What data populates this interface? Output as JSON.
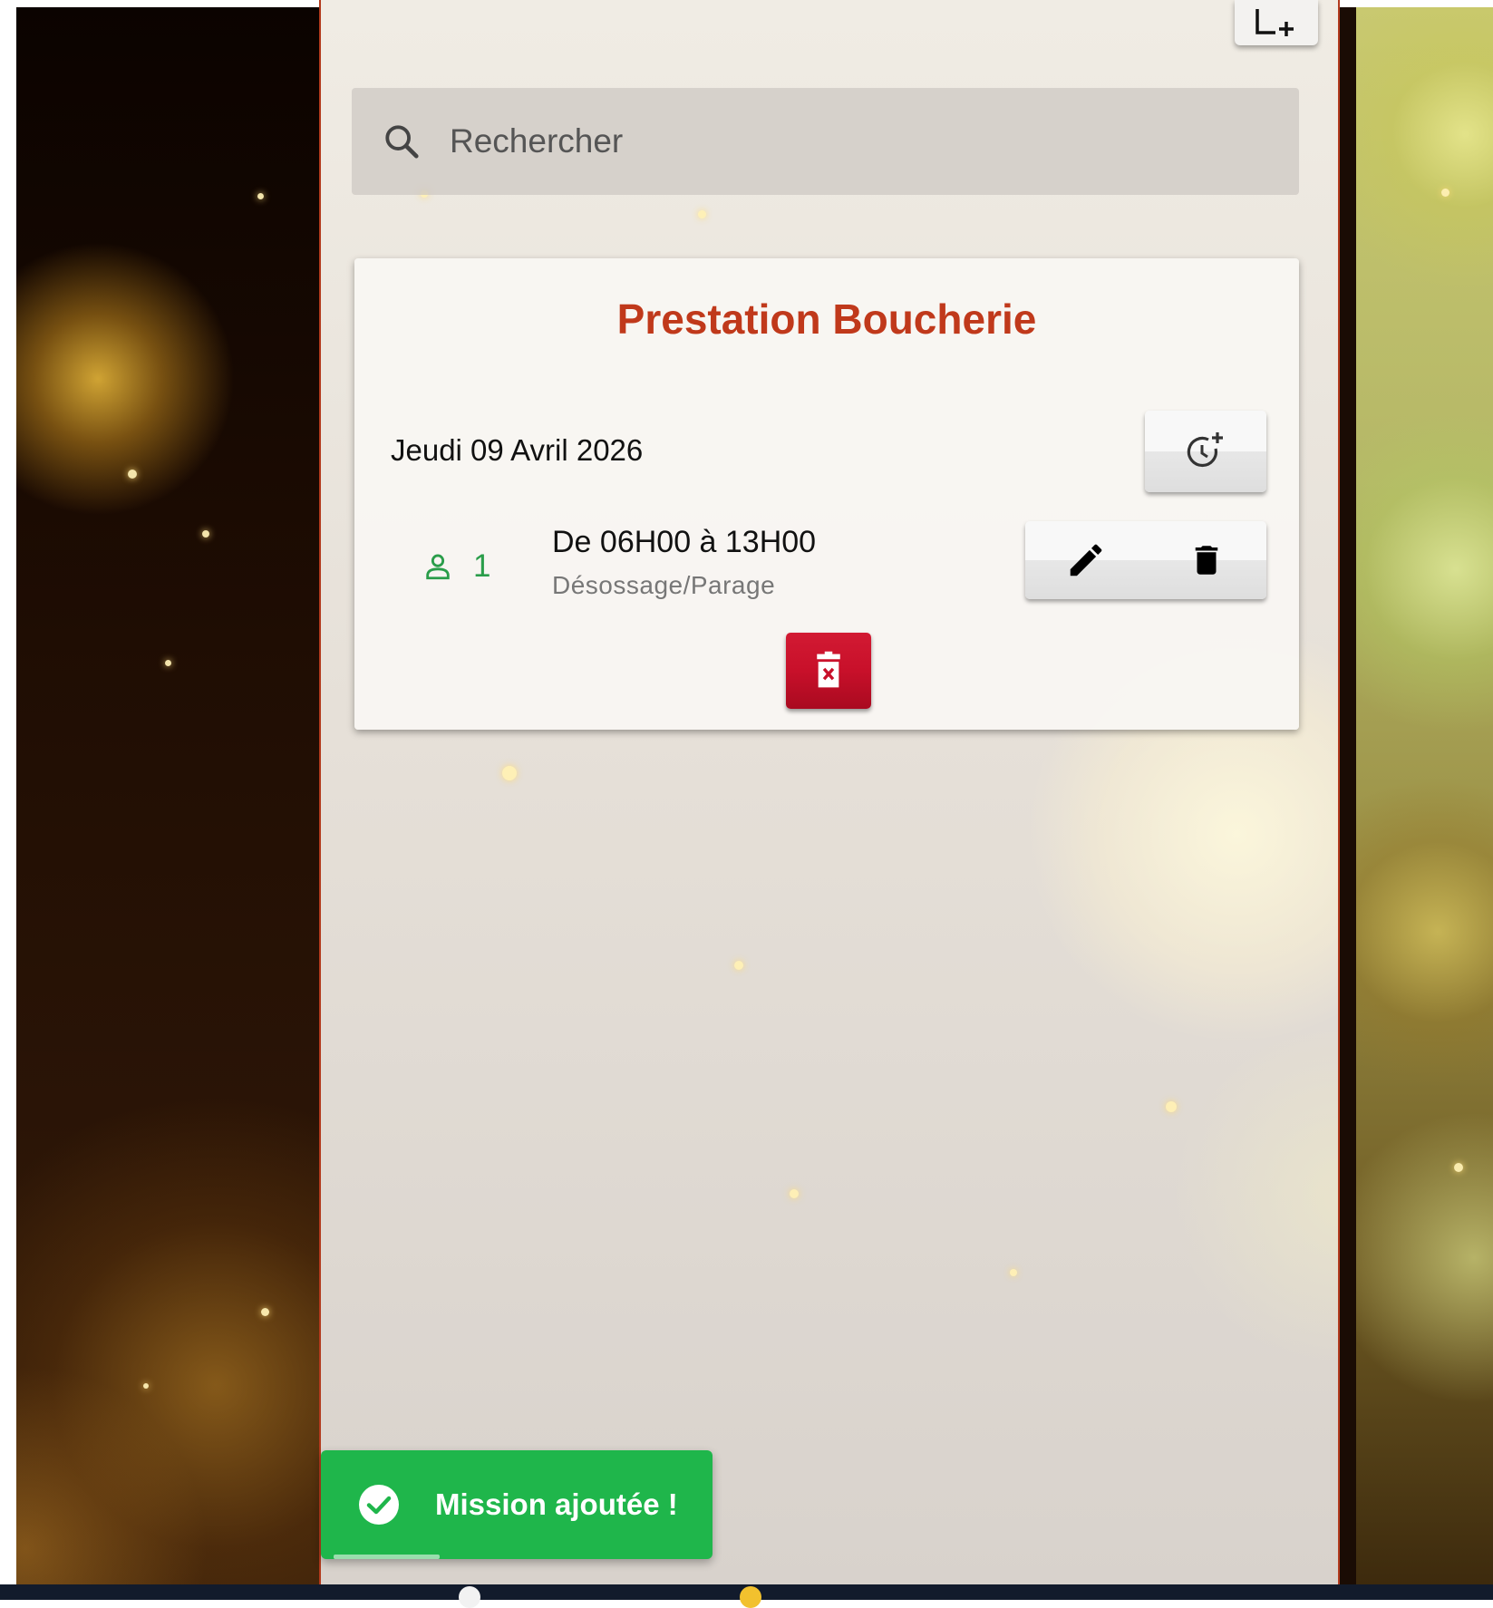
{
  "search": {
    "placeholder": "Rechercher"
  },
  "mission_card": {
    "title": "Prestation Boucherie",
    "date": "Jeudi 09 Avril 2026",
    "missions": [
      {
        "staff_count": "1",
        "time_range": "De 06H00 à 13H00",
        "task": "Désossage/Parage"
      }
    ]
  },
  "toast": {
    "message": "Mission ajoutée !",
    "progress": 0.27
  },
  "icons": {
    "top_right": "add-frame-icon",
    "search": "search-icon",
    "add_time": "clock-plus-icon",
    "staff": "person-icon",
    "edit": "pencil-icon",
    "delete": "trash-icon",
    "delete_mission": "trash-x-icon",
    "toast": "check-circle-icon"
  },
  "colors": {
    "title": "#c0391b",
    "staff": "#2a9d4a",
    "danger": "#c8102a",
    "toast": "#1fb64b",
    "border_accent": "#b23a1d"
  }
}
